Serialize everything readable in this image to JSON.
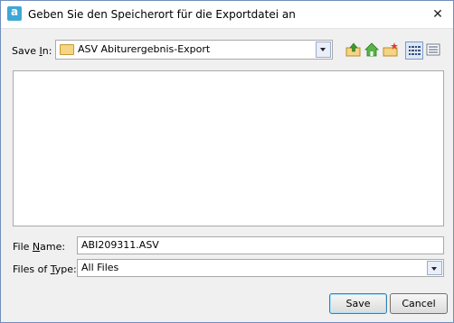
{
  "window": {
    "title": "Geben Sie den Speicherort für die Exportdatei an",
    "app_icon_letter": "a"
  },
  "save_in": {
    "label_pre": "Save ",
    "label_ul": "I",
    "label_post": "n:",
    "value": "ASV Abiturergebnis-Export"
  },
  "toolbar": {
    "icons": [
      "up-one-level-icon",
      "home-icon",
      "new-folder-icon",
      "list-view-icon",
      "details-view-icon"
    ]
  },
  "file_name": {
    "label_pre": "File ",
    "label_ul": "N",
    "label_post": "ame:",
    "value": "ABI209311.ASV"
  },
  "file_type": {
    "label_pre": "Files of ",
    "label_ul": "T",
    "label_post": "ype:",
    "value": "All Files"
  },
  "buttons": {
    "save": "Save",
    "cancel": "Cancel"
  }
}
